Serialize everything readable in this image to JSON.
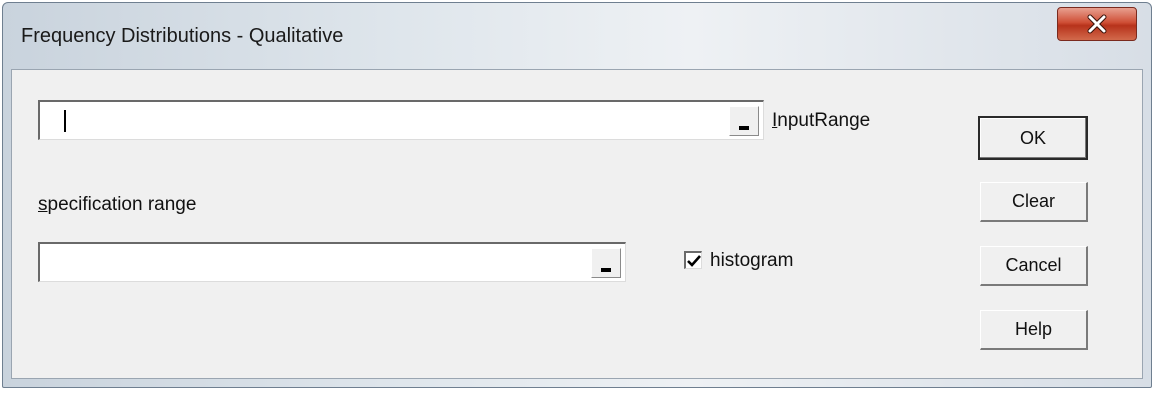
{
  "window": {
    "title": "Frequency Distributions - Qualitative",
    "close_icon": "close-x-icon"
  },
  "input_range": {
    "value": "",
    "label_prefix": "",
    "label_accel": "I",
    "label_rest": "nputRange",
    "ref_icon": "collapse-dialog-icon"
  },
  "spec_range": {
    "label_accel": "s",
    "label_rest": "pecification range",
    "value": "",
    "ref_icon": "collapse-dialog-icon"
  },
  "histogram": {
    "label_pre": "histo",
    "label_accel": "g",
    "label_post": "ram",
    "checked": true
  },
  "buttons": {
    "ok": "OK",
    "clear": "Clear",
    "cancel": "Cancel",
    "help": "Help"
  }
}
